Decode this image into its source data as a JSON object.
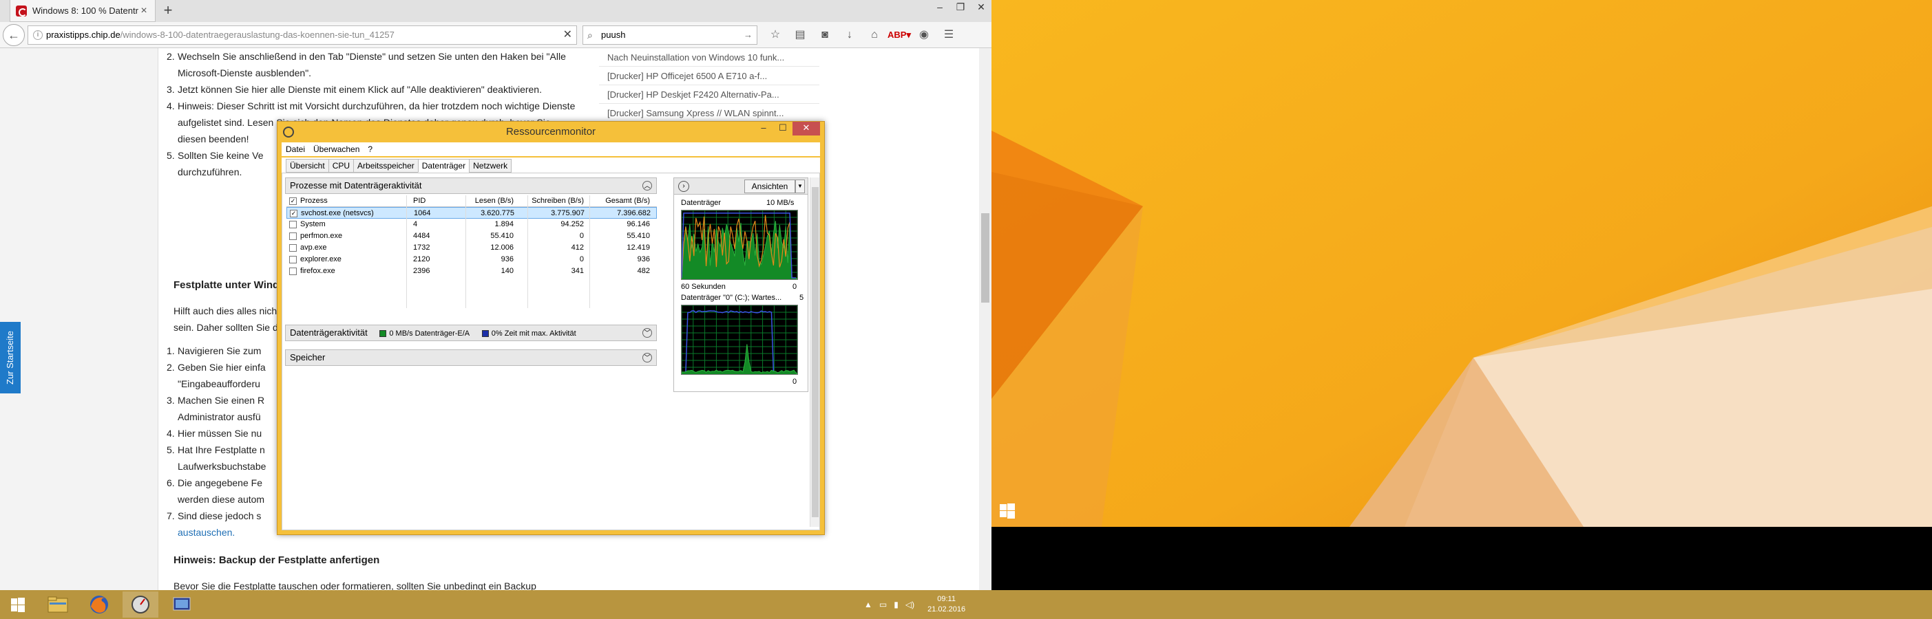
{
  "browser": {
    "tab_title": "Windows 8: 100 % Datentr...",
    "new_tab": "+",
    "url_host": "praxistipps.chip.de",
    "url_path": "/windows-8-100-datentraegerauslastung-das-koennen-sie-tun_41257",
    "search_value": "puush",
    "window_buttons": [
      "–",
      "❐",
      "✕"
    ]
  },
  "article": {
    "items": [
      {
        "num": "2.",
        "lines": [
          "Wechseln Sie anschließend in den Tab \"Dienste\" und setzen Sie unten den Haken bei \"Alle",
          "Microsoft-Dienste ausblenden\"."
        ]
      },
      {
        "num": "3.",
        "lines": [
          "Jetzt können Sie hier alle Dienste mit einem Klick auf \"Alle deaktivieren\" deaktivieren."
        ]
      },
      {
        "num": "4.",
        "lines": [
          "Hinweis: Dieser Schritt ist mit Vorsicht durchzuführen, da hier trotzdem noch wichtige Dienste",
          "aufgelistet sind. Lesen Sie sich den Namen des Dienstes daher genau durch, bevor Sie",
          "diesen beenden!"
        ]
      },
      {
        "num": "5.",
        "lines": [
          "Sollten Sie keine Ve",
          "durchzuführen."
        ]
      }
    ],
    "heading1": "Festplatte unter Wind",
    "para1": [
      "Hilft auch dies alles nich",
      "sein. Daher sollten Sie d"
    ],
    "items2": [
      {
        "num": "1.",
        "lines": [
          "Navigieren Sie zum"
        ]
      },
      {
        "num": "2.",
        "lines": [
          "Geben Sie hier einfa",
          "\"Eingabeaufforderu"
        ]
      },
      {
        "num": "3.",
        "lines": [
          "Machen Sie einen R",
          "Administrator ausfü"
        ]
      },
      {
        "num": "4.",
        "lines": [
          "Hier müssen Sie nu"
        ]
      },
      {
        "num": "5.",
        "lines": [
          "Hat Ihre Festplatte n",
          "Laufwerksbuchstabe"
        ]
      },
      {
        "num": "6.",
        "lines": [
          "Die angegebene Fe",
          "werden diese autom"
        ]
      },
      {
        "num": "7.",
        "lines": [
          "Sind diese jedoch s"
        ]
      }
    ],
    "link_text": "austauschen.",
    "heading2": "Hinweis: Backup der Festplatte anfertigen",
    "para2": "Bevor Sie die Festplatte tauschen oder formatieren, sollten Sie unbedingt ein Backup",
    "side_tab": "Zur Startseite"
  },
  "sidebar": [
    "Nach Neuinstallation von Windows 10 funk...",
    "[Drucker] HP Officejet 6500 A E710 a-f...",
    "[Drucker] HP Deskjet F2420 Alternativ-Pa...",
    "[Drucker] Samsung Xpress // WLAN spinnt..."
  ],
  "resmon": {
    "title": "Ressourcenmonitor",
    "menu": [
      "Datei",
      "Überwachen",
      "?"
    ],
    "tabs": [
      "Übersicht",
      "CPU",
      "Arbeitsspeicher",
      "Datenträger",
      "Netzwerk"
    ],
    "active_tab": "Datenträger",
    "section_processes": "Prozesse mit Datenträgeraktivität",
    "columns": {
      "name": "Prozess",
      "pid": "PID",
      "read": "Lesen (B/s)",
      "write": "Schreiben (B/s)",
      "total": "Gesamt (B/s)"
    },
    "rows": [
      {
        "name": "svchost.exe (netsvcs)",
        "pid": "1064",
        "read": "3.620.775",
        "write": "3.775.907",
        "total": "7.396.682",
        "checked": true
      },
      {
        "name": "System",
        "pid": "4",
        "read": "1.894",
        "write": "94.252",
        "total": "96.146",
        "checked": false
      },
      {
        "name": "perfmon.exe",
        "pid": "4484",
        "read": "55.410",
        "write": "0",
        "total": "55.410",
        "checked": false
      },
      {
        "name": "avp.exe",
        "pid": "1732",
        "read": "12.006",
        "write": "412",
        "total": "12.419",
        "checked": false
      },
      {
        "name": "explorer.exe",
        "pid": "2120",
        "read": "936",
        "write": "0",
        "total": "936",
        "checked": false
      },
      {
        "name": "firefox.exe",
        "pid": "2396",
        "read": "140",
        "write": "341",
        "total": "482",
        "checked": false
      }
    ],
    "section_disk": "Datenträgeraktivität",
    "disk_io": "0 MB/s Datenträger-E/A",
    "disk_active": "0% Zeit mit max. Aktivität",
    "section_storage": "Speicher",
    "views_button": "Ansichten",
    "graph1_label": "Datenträger",
    "graph1_max": "10 MB/s",
    "graph1_time": "60 Sekunden",
    "graph1_min": "0",
    "graph2_label": "Datenträger \"0\" (C:); Wartes...",
    "graph2_max": "5",
    "graph2_min": "0"
  },
  "taskbar": {
    "clock_time": "09:11",
    "clock_date": "21.02.2016"
  },
  "colors": {
    "desktop": "#f5a81a",
    "taskbar": "#b8953f",
    "rm_frame": "#f5c03a",
    "graph_grid": "#0a7a2a"
  }
}
